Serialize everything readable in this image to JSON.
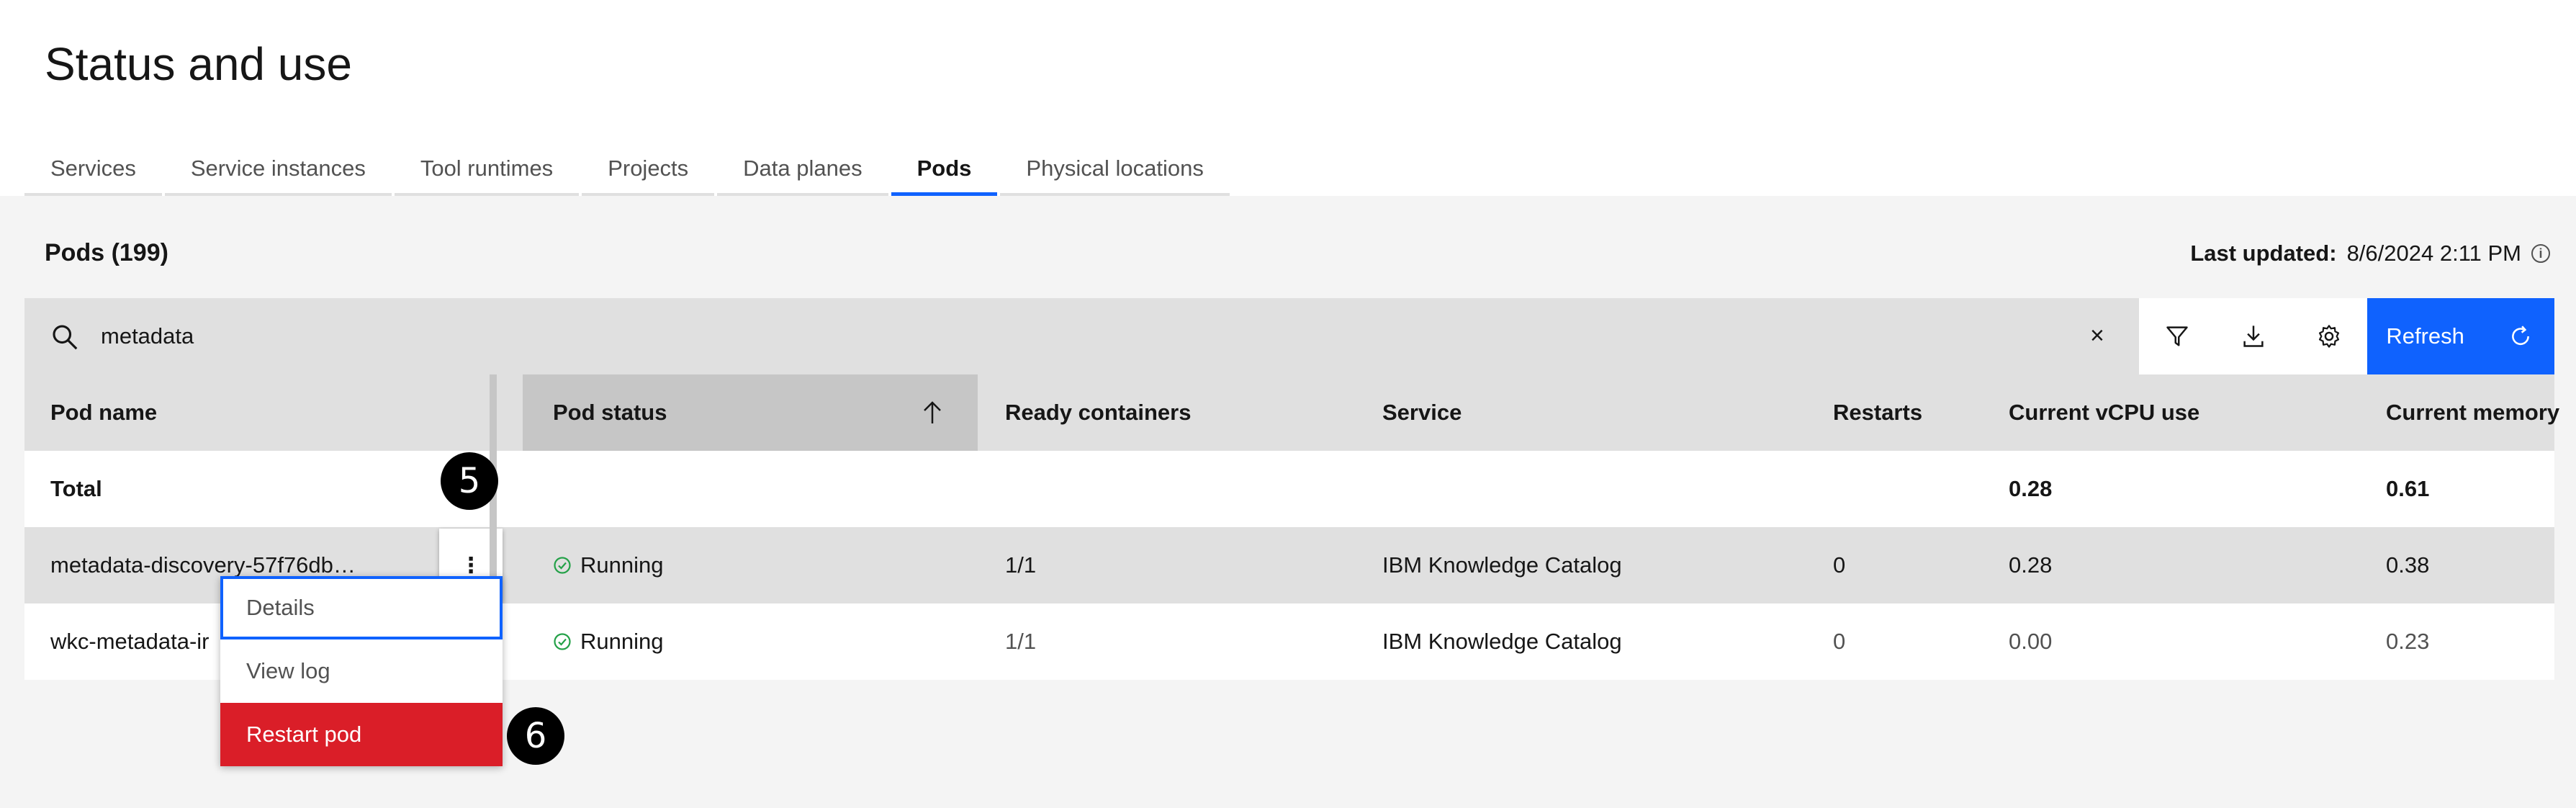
{
  "page": {
    "title": "Status and use"
  },
  "tabs": [
    {
      "label": "Services"
    },
    {
      "label": "Service instances"
    },
    {
      "label": "Tool runtimes"
    },
    {
      "label": "Projects"
    },
    {
      "label": "Data planes"
    },
    {
      "label": "Pods",
      "active": true
    },
    {
      "label": "Physical locations"
    }
  ],
  "pods": {
    "title": "Pods (199)",
    "last_updated_label": "Last updated:",
    "last_updated_value": "8/6/2024 2:11 PM"
  },
  "toolbar": {
    "search_value": "metadata",
    "refresh_label": "Refresh"
  },
  "table": {
    "columns": [
      "Pod name",
      "Pod status",
      "Ready containers",
      "Service",
      "Restarts",
      "Current vCPU use",
      "Current memory"
    ],
    "total": {
      "label": "Total",
      "vcpu": "0.28",
      "memory": "0.61"
    },
    "rows": [
      {
        "name": "metadata-discovery-57f76db…",
        "status": "Running",
        "ready": "1/1",
        "service": "IBM Knowledge Catalog",
        "restarts": "0",
        "vcpu": "0.28",
        "memory": "0.38"
      },
      {
        "name": "wkc-metadata-ir",
        "status": "Running",
        "ready": "1/1",
        "service": "IBM Knowledge Catalog",
        "restarts": "0",
        "vcpu": "0.00",
        "memory": "0.23"
      }
    ]
  },
  "menu": {
    "items": [
      "Details",
      "View log",
      "Restart pod"
    ]
  },
  "badges": {
    "b5": "5",
    "b6": "6"
  },
  "colors": {
    "accent": "#0f62fe",
    "danger": "#da1e28",
    "success": "#24a148"
  }
}
